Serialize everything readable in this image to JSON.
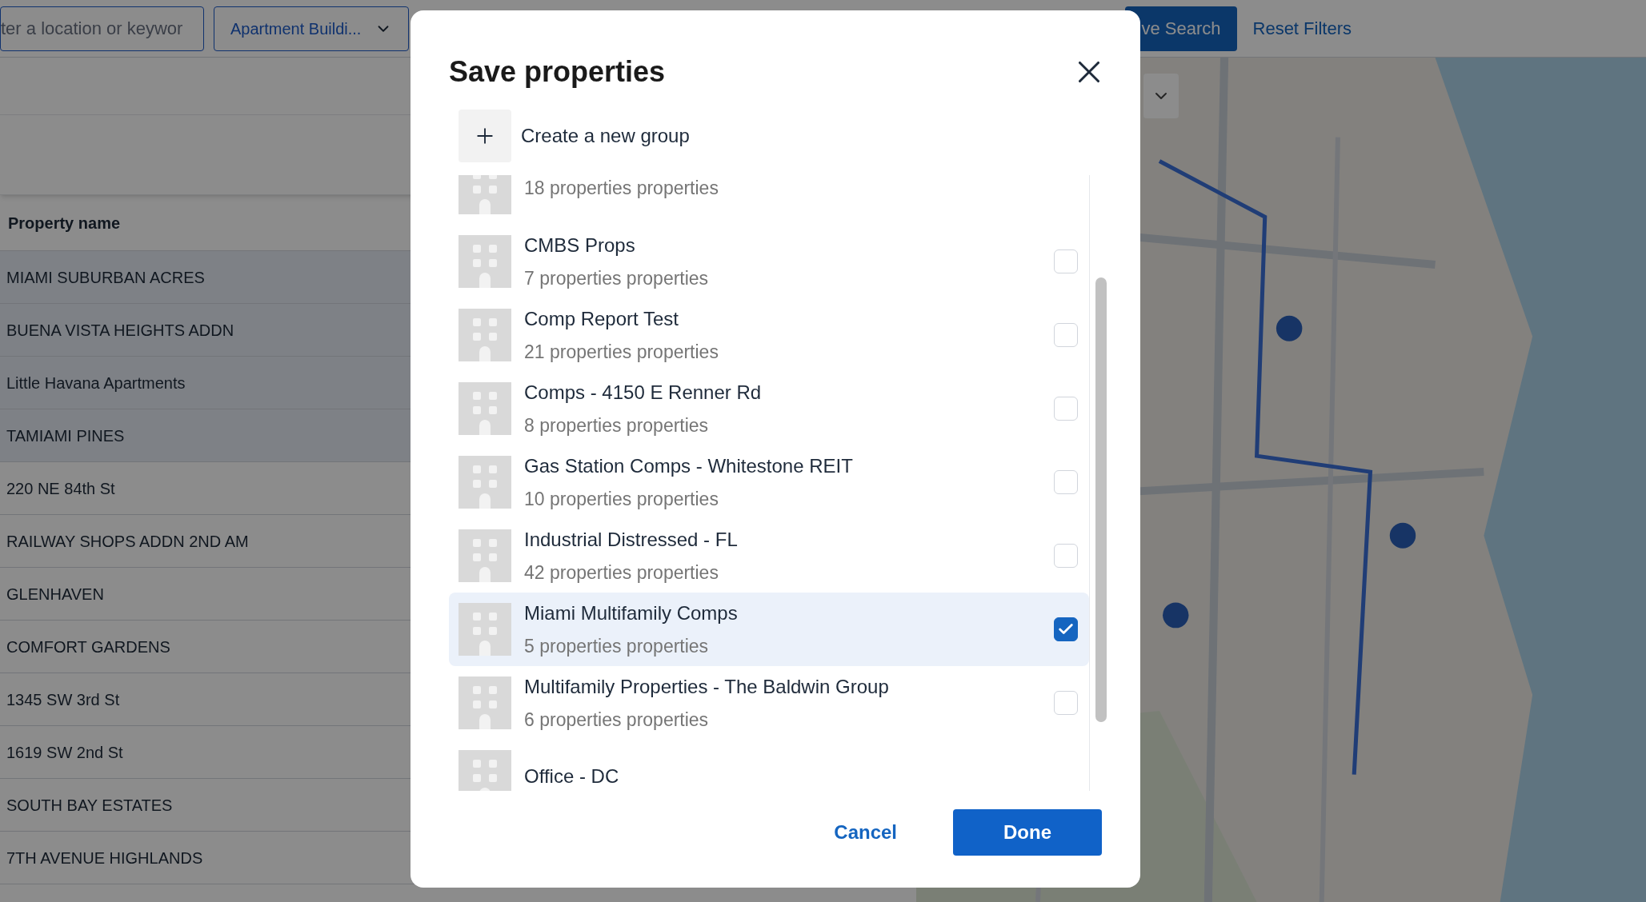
{
  "toolbar": {
    "search": {
      "value": "ter a location or keywor"
    },
    "type_filter": {
      "value": "Apartment Buildi..."
    },
    "save_search": "ve Search",
    "reset_filters": "Reset Filters"
  },
  "table": {
    "columns": [
      "Property name"
    ],
    "rows": [
      {
        "name": "MIAMI SUBURBAN ACRES",
        "highlighted": true
      },
      {
        "name": "BUENA VISTA HEIGHTS ADDN",
        "highlighted": true
      },
      {
        "name": "Little Havana Apartments",
        "highlighted": true
      },
      {
        "name": "TAMIAMI PINES",
        "highlighted": true
      },
      {
        "name": "220 NE 84th St",
        "highlighted": false
      },
      {
        "name": "RAILWAY SHOPS ADDN 2ND AM",
        "highlighted": false
      },
      {
        "name": "GLENHAVEN",
        "highlighted": false
      },
      {
        "name": "COMFORT GARDENS",
        "highlighted": false
      },
      {
        "name": "1345 SW 3rd St",
        "highlighted": false
      },
      {
        "name": "1619 SW 2nd St",
        "highlighted": false
      },
      {
        "name": "SOUTH BAY ESTATES",
        "highlighted": false
      },
      {
        "name": "7TH AVENUE HIGHLANDS",
        "highlighted": false
      }
    ]
  },
  "dialog": {
    "title": "Save properties",
    "create_group": "Create a new group",
    "groups": [
      {
        "count": "18 properties properties"
      },
      {
        "name": "CMBS Props",
        "count": "7 properties properties",
        "checked": false
      },
      {
        "name": "Comp Report Test",
        "count": "21 properties properties",
        "checked": false
      },
      {
        "name": "Comps - 4150 E Renner Rd",
        "count": "8 properties properties",
        "checked": false
      },
      {
        "name": "Gas Station Comps - Whitestone REIT",
        "count": "10 properties properties",
        "checked": false
      },
      {
        "name": "Industrial Distressed - FL",
        "count": "42 properties properties",
        "checked": false
      },
      {
        "name": "Miami Multifamily Comps",
        "count": "5 properties properties",
        "checked": true
      },
      {
        "name": "Multifamily Properties - The Baldwin Group",
        "count": "6 properties properties",
        "checked": false
      },
      {
        "name": "Office - DC"
      }
    ],
    "cancel": "Cancel",
    "done": "Done"
  }
}
